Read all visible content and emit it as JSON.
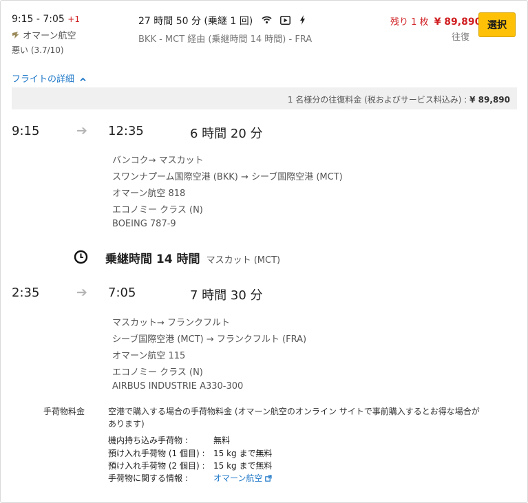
{
  "header": {
    "time_range": "9:15 - 7:05",
    "day_offset": "+1",
    "airline": "オマーン航空",
    "rating": "悪い (3.7/10)",
    "duration_summary": "27 時間 50 分 (乗継 1 回)",
    "route_summary": "BKK - MCT 経由 (乗継時間 14 時間) - FRA",
    "seats_left": "残り 1 枚",
    "price": "¥ 89,890",
    "trip_type": "往復",
    "select_label": "選択",
    "amenity_icons": [
      "wifi-icon",
      "video-icon",
      "power-icon"
    ]
  },
  "details_toggle": {
    "label": "フライトの詳細",
    "icon": "chevron-up-icon"
  },
  "price_bar": {
    "label": "1 名様分の往復料金 (税およびサービス料込み) :",
    "price": "¥ 89,890"
  },
  "segments": [
    {
      "depart": "9:15",
      "arrive": "12:35",
      "duration": "6 時間 20 分",
      "info": [
        "バンコク→ マスカット",
        "スワンナプーム国際空港 (BKK) → シーブ国際空港 (MCT)",
        "オマーン航空 818",
        "エコノミー クラス (N)",
        "BOEING 787-9"
      ]
    },
    {
      "depart": "2:35",
      "arrive": "7:05",
      "duration": "7 時間 30 分",
      "info": [
        "マスカット→ フランクフルト",
        "シーブ国際空港 (MCT) → フランクフルト (FRA)",
        "オマーン航空 115",
        "エコノミー クラス (N)",
        "AIRBUS INDUSTRIE A330-300"
      ]
    }
  ],
  "layover": {
    "title": "乗継時間 14 時間",
    "place": "マスカット (MCT)"
  },
  "baggage": {
    "heading": "手荷物料金",
    "note_line1": "空港で購入する場合の手荷物料金 (オマーン航空のオンライン サイトで事前購入するとお得な場合が",
    "note_line2": "あります)",
    "rows": [
      {
        "label": "機内持ち込み手荷物 :",
        "value": "無料"
      },
      {
        "label": "預け入れ手荷物 (1 個目) :",
        "value": "15 kg まで無料"
      },
      {
        "label": "預け入れ手荷物 (2 個目) :",
        "value": "15 kg まで無料"
      },
      {
        "label": "手荷物に関する情報 :",
        "value": "オマーン航空"
      }
    ]
  },
  "colors": {
    "accent_blue": "#1f78c8",
    "price_red": "#d01e21",
    "select_yellow": "#ffc107"
  }
}
